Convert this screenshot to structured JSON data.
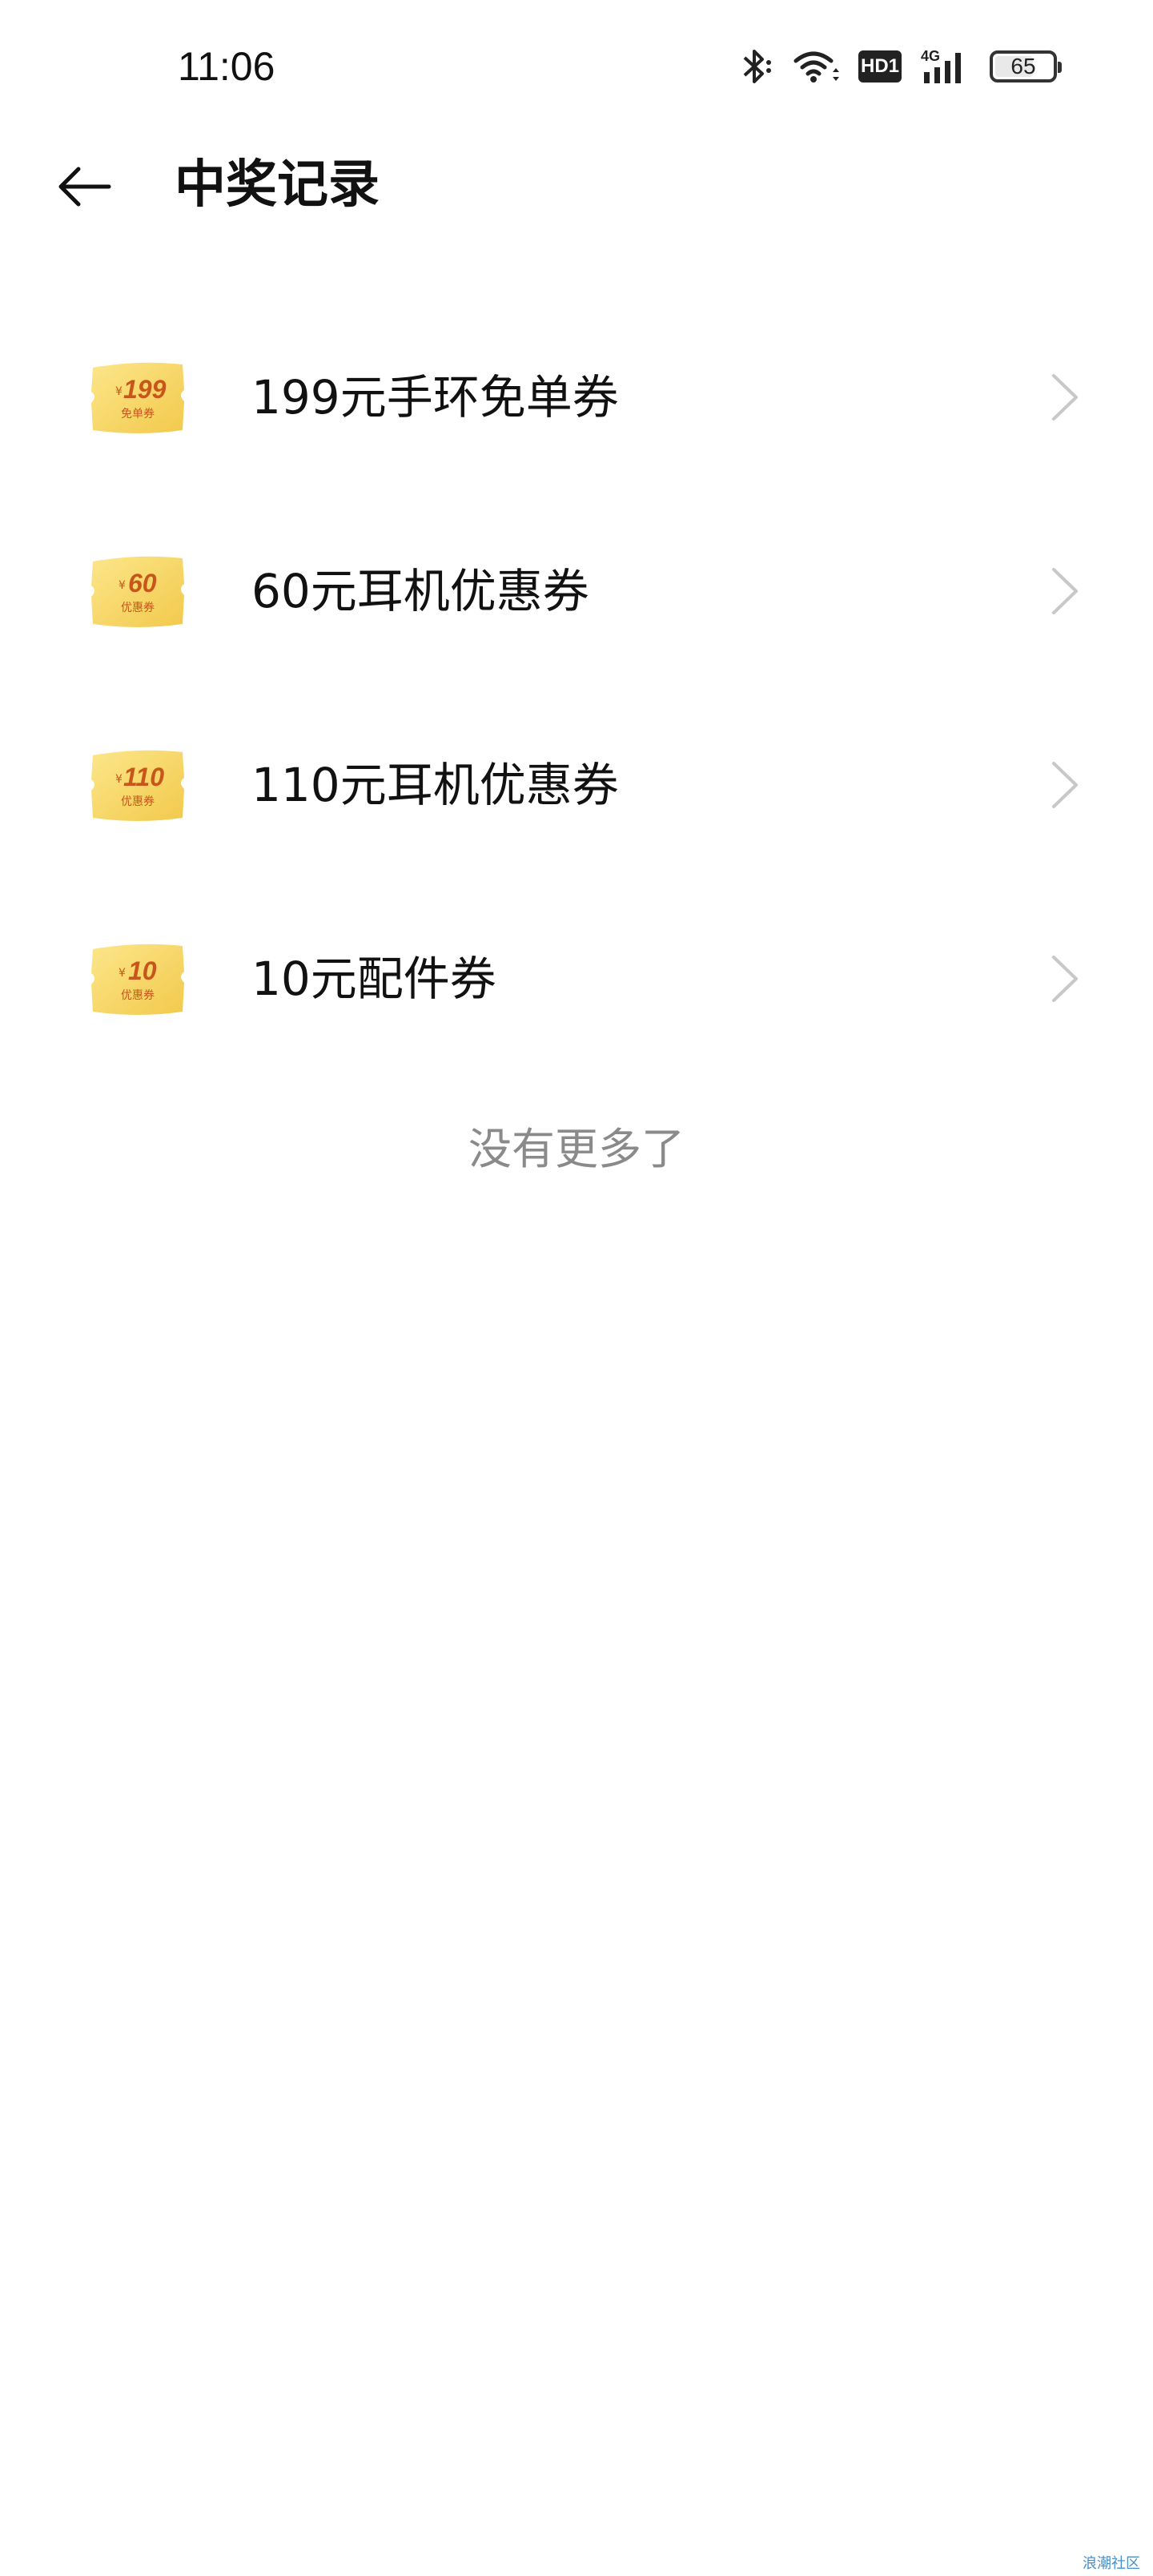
{
  "status_bar": {
    "time": "11:06",
    "icons": [
      "bluetooth-icon",
      "wifi-icon",
      "hd-icon",
      "signal-4g-icon",
      "battery-icon"
    ],
    "hd_label": "HD1",
    "network_label": "4G",
    "battery_level": "65"
  },
  "header": {
    "back_icon": "arrow-left-icon",
    "title": "中奖记录"
  },
  "prizes": [
    {
      "label": "199元手环免单券",
      "coupon_amount": "199",
      "coupon_type": "免单券"
    },
    {
      "label": "60元耳机优惠券",
      "coupon_amount": "60",
      "coupon_type": "优惠券"
    },
    {
      "label": "110元耳机优惠券",
      "coupon_amount": "110",
      "coupon_type": "优惠券"
    },
    {
      "label": "10元配件券",
      "coupon_amount": "10",
      "coupon_type": "优惠券"
    }
  ],
  "end_text": "没有更多了",
  "watermark": "浪潮社区",
  "colors": {
    "coupon_gold": "#F6D65C",
    "coupon_text": "#C8561B",
    "chevron": "#C8C8C8",
    "end_text": "#8A8A8A"
  }
}
